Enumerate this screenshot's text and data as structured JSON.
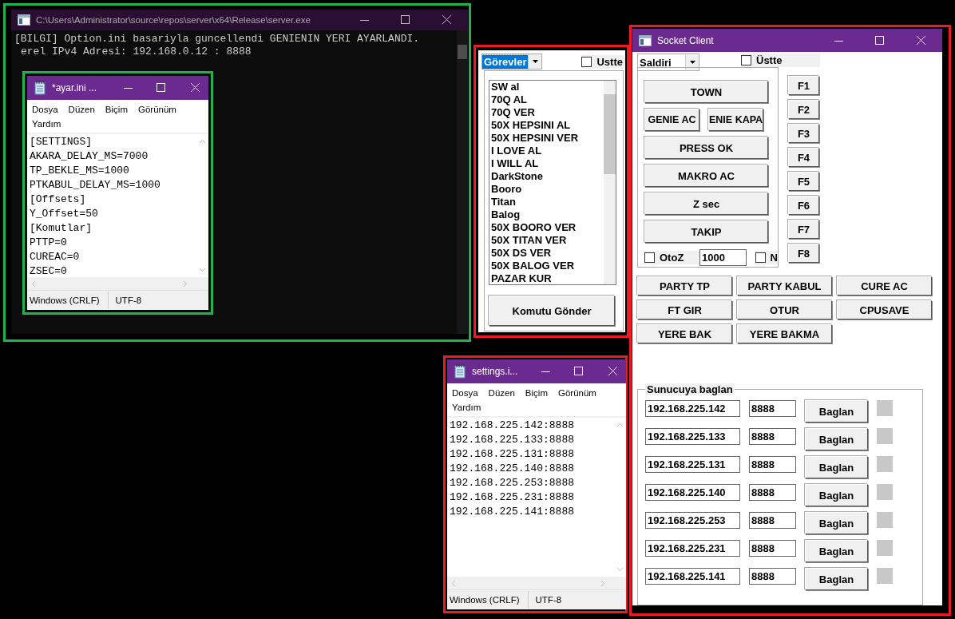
{
  "console": {
    "title": "C:\\Users\\Administrator\\source\\repos\\server\\x64\\Release\\server.exe",
    "lines": [
      "[BILGI] Option.ini basariyla guncellendi GENIENIN YERI AYARLANDI.",
      "erel IPv4 Adresi: 192.168.0.12 : 8888"
    ]
  },
  "ayar_notepad": {
    "title": "*ayar.ini ...",
    "menu": [
      "Dosya",
      "Düzen",
      "Biçim",
      "Görünüm",
      "Yardım"
    ],
    "lines": [
      "[SETTINGS]",
      "AKARA_DELAY_MS=7000",
      "TP_BEKLE_MS=1000",
      "PTKABUL_DELAY_MS=1000",
      "[Offsets]",
      "Y_Offset=50",
      "[Komutlar]",
      "PTTP=0",
      "CUREAC=0",
      "ZSEC=0"
    ],
    "status": [
      "Windows (CRLF)",
      "UTF-8"
    ]
  },
  "commands_panel": {
    "dropdown": {
      "value": "Görevler"
    },
    "topmost_checkbox": {
      "label": "Ustte",
      "checked": false
    },
    "list_items": [
      "SW al",
      "70Q AL",
      "70Q VER",
      "50X HEPSINI AL",
      "50X HEPSINI VER",
      "I LOVE AL",
      "I WILL AL",
      "DarkStone",
      "Booro",
      "Titan",
      "Balog",
      "50X BOORO VER",
      "50X TITAN VER",
      "50X DS VER",
      "50X BALOG VER",
      "PAZAR KUR"
    ],
    "send_button": "Komutu Gönder"
  },
  "settings_notepad": {
    "title": "settings.i...",
    "menu": [
      "Dosya",
      "Düzen",
      "Biçim",
      "Görünüm",
      "Yardım"
    ],
    "lines": [
      "192.168.225.142:8888",
      "192.168.225.133:8888",
      "192.168.225.131:8888",
      "192.168.225.140:8888",
      "192.168.225.253:8888",
      "192.168.225.231:8888",
      "192.168.225.141:8888"
    ],
    "status": [
      "Windows (CRLF)",
      "UTF-8"
    ]
  },
  "socket_client": {
    "title": "Socket Client",
    "mode_dropdown": {
      "value": "Saldiri"
    },
    "topmost_checkbox": {
      "label": "Üstte",
      "checked": false
    },
    "action_buttons": [
      {
        "label": "TOWN",
        "kind": "full"
      },
      {
        "label": "GENIE AC",
        "kind": "half"
      },
      {
        "label": "ENIE KAPA",
        "kind": "half"
      },
      {
        "label": "PRESS OK",
        "kind": "full"
      },
      {
        "label": "MAKRO AC",
        "kind": "full"
      },
      {
        "label": "Z sec",
        "kind": "full"
      },
      {
        "label": "TAKIP",
        "kind": "full"
      }
    ],
    "function_keys": [
      "F1",
      "F2",
      "F3",
      "F4",
      "F5",
      "F6",
      "F7",
      "F8"
    ],
    "otoz_checkbox": {
      "label": "OtoZ",
      "checked": false
    },
    "interval_field": {
      "value": "1000"
    },
    "n_checkbox": {
      "label": "N",
      "checked": false
    },
    "bottom_buttons": [
      "PARTY TP",
      "PARTY KABUL",
      "CURE AC",
      "FT GIR",
      "OTUR",
      "CPUSAVE",
      "YERE BAK",
      "YERE BAKMA"
    ],
    "server_group": {
      "title": "Sunucuya baglan",
      "servers": [
        {
          "ip": "192.168.225.142",
          "port": "8888",
          "button": "Baglan",
          "connected": false
        },
        {
          "ip": "192.168.225.133",
          "port": "8888",
          "button": "Baglan",
          "connected": false
        },
        {
          "ip": "192.168.225.131",
          "port": "8888",
          "button": "Baglan",
          "connected": false
        },
        {
          "ip": "192.168.225.140",
          "port": "8888",
          "button": "Baglan",
          "connected": false
        },
        {
          "ip": "192.168.225.253",
          "port": "8888",
          "button": "Baglan",
          "connected": false
        },
        {
          "ip": "192.168.225.231",
          "port": "8888",
          "button": "Baglan",
          "connected": false
        },
        {
          "ip": "192.168.225.141",
          "port": "8888",
          "button": "Baglan",
          "connected": false
        }
      ]
    }
  }
}
